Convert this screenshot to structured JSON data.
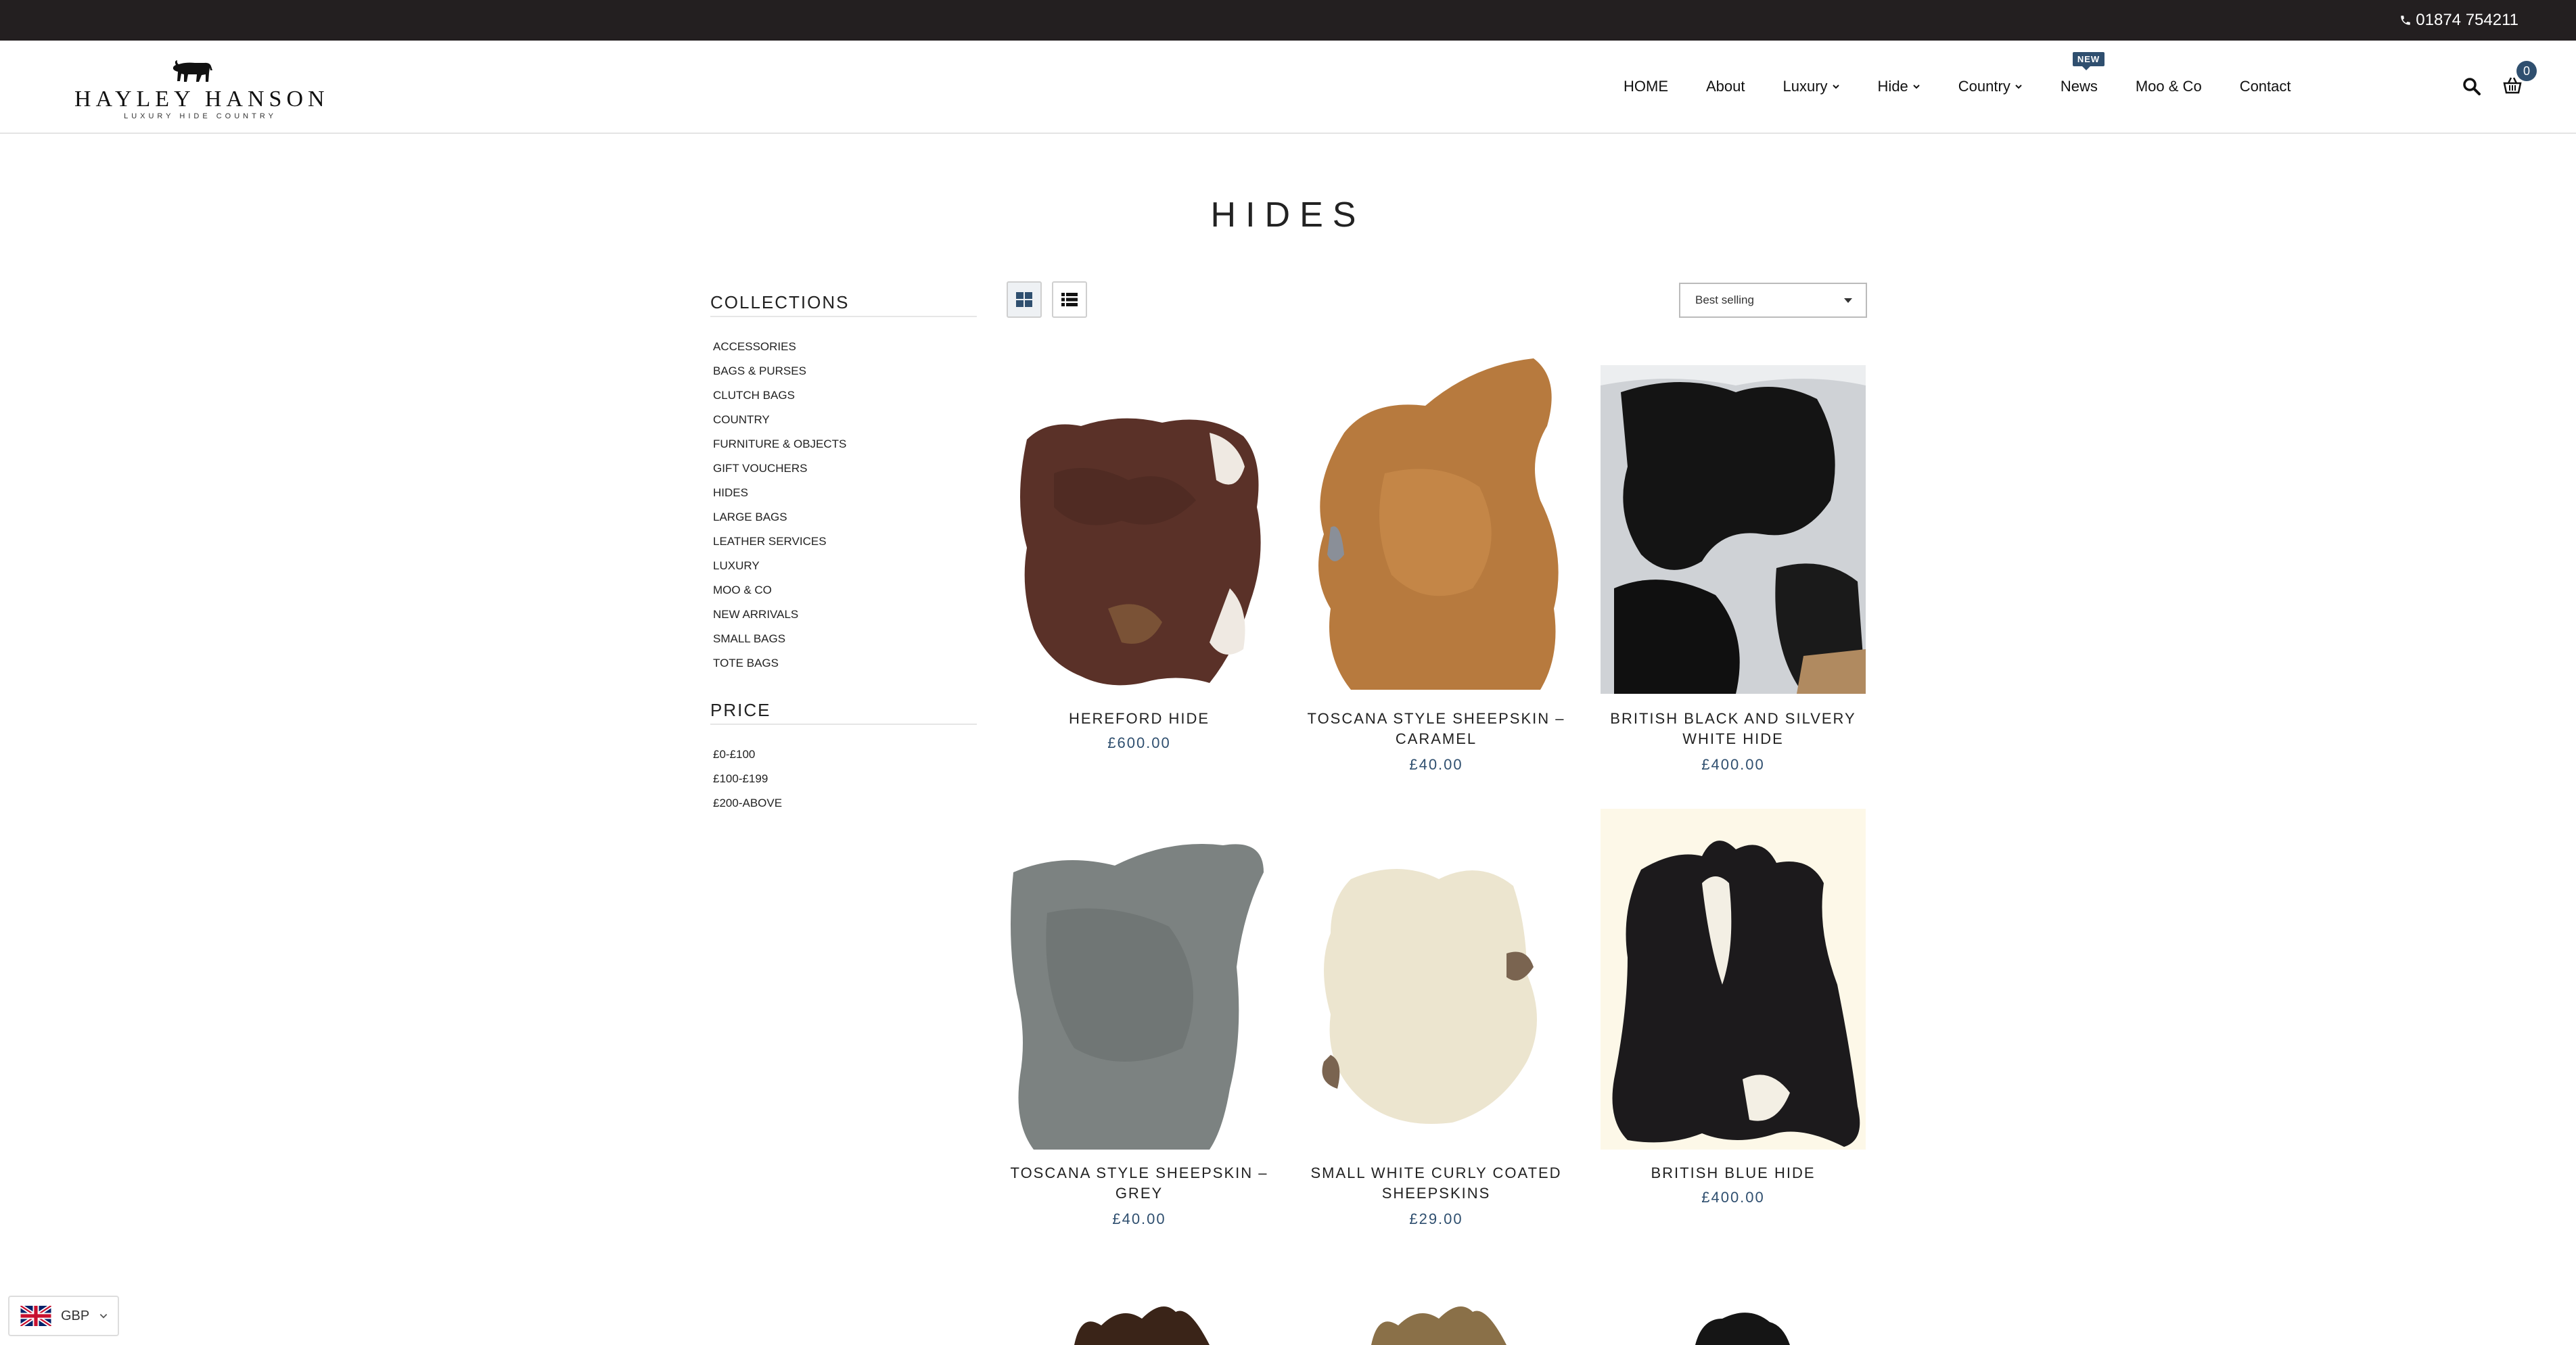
{
  "topbar": {
    "phone": "01874 754211",
    "icon": "phone-icon"
  },
  "brand": {
    "name": "HAYLEY HANSON",
    "tagline": "LUXURY   HIDE   COUNTRY",
    "logo_icon": "bull-icon"
  },
  "nav": {
    "home": "HOME",
    "about": "About",
    "luxury": "Luxury",
    "hide": "Hide",
    "country": "Country",
    "news": "News",
    "news_badge": "NEW",
    "moo": "Moo & Co",
    "contact": "Contact"
  },
  "header_icons": {
    "search": "search-icon",
    "cart": "basket-icon",
    "cart_count": "0"
  },
  "page": {
    "title": "HIDES"
  },
  "sidebar": {
    "collections_heading": "COLLECTIONS",
    "collections": [
      "ACCESSORIES",
      "BAGS & PURSES",
      "CLUTCH BAGS",
      "COUNTRY",
      "FURNITURE & OBJECTS",
      "GIFT VOUCHERS",
      "HIDES",
      "LARGE BAGS",
      "LEATHER SERVICES",
      "LUXURY",
      "MOO & CO",
      "NEW ARRIVALS",
      "SMALL BAGS",
      "TOTE BAGS"
    ],
    "price_heading": "PRICE",
    "prices": [
      "£0-£100",
      "£100-£199",
      "£200-ABOVE"
    ]
  },
  "toolbar": {
    "grid_view": "grid-icon",
    "list_view": "list-icon",
    "sort_selected": "Best selling"
  },
  "products": [
    {
      "title": "HEREFORD HIDE",
      "price": "£600.00"
    },
    {
      "title": "TOSCANA STYLE SHEEPSKIN – CARAMEL",
      "price": "£40.00"
    },
    {
      "title": "BRITISH BLACK AND SILVERY WHITE HIDE",
      "price": "£400.00"
    },
    {
      "title": "TOSCANA STYLE SHEEPSKIN – GREY",
      "price": "£40.00"
    },
    {
      "title": "SMALL WHITE CURLY COATED SHEEPSKINS",
      "price": "£29.00"
    },
    {
      "title": "BRITISH BLUE HIDE",
      "price": "£400.00"
    }
  ],
  "colors": {
    "accent": "#2f4f6f",
    "topbar": "#231f20"
  },
  "currency": {
    "code": "GBP",
    "flag": "uk-flag-icon"
  }
}
